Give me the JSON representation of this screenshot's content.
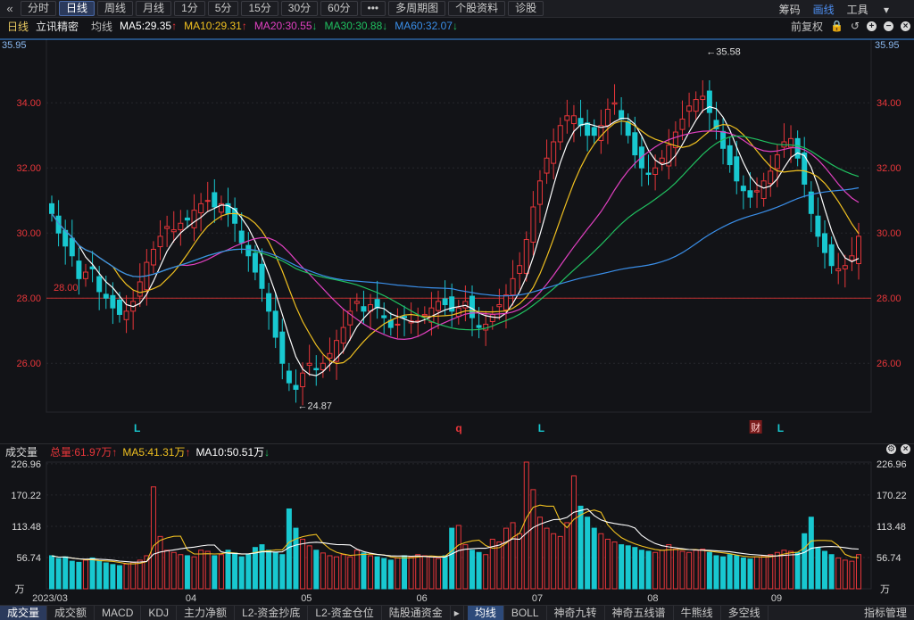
{
  "toolbar": {
    "back_icon": "double-chevron-left",
    "buttons": [
      "分时",
      "日线",
      "周线",
      "月线",
      "1分",
      "5分",
      "15分",
      "30分",
      "60分",
      "•••",
      "多周期图",
      "个股资料",
      "诊股"
    ],
    "active_button": "日线",
    "right": {
      "chips": "筹码",
      "ruler": "画线",
      "tools": "工具",
      "tools_arrow": "▾"
    }
  },
  "legend": {
    "period": "日线",
    "stock": "立讯精密",
    "ma_label": "均线",
    "ma5": "MA5:29.35",
    "ma10": "MA10:29.31",
    "ma20": "MA20:30.55",
    "ma30": "MA30:30.88",
    "ma60": "MA60:32.07",
    "adjust": "前复权"
  },
  "colors": {
    "up": "#e8363a",
    "down": "#18c8d0",
    "ma5": "#ffffff",
    "ma10": "#f0c020",
    "ma20": "#e040c0",
    "ma30": "#20c060",
    "ma60": "#3a8ee8",
    "grid": "#26272d",
    "axis_text": "#e8363a"
  },
  "markers": {
    "high_label": "35.58",
    "low_label": "24.87",
    "ref_line": "28.00",
    "top_right_price": "35.95",
    "top_left_price": "35.95",
    "signals": [
      "L",
      "q",
      "L",
      "财",
      "L"
    ]
  },
  "volume": {
    "title": "成交量",
    "total": "总量:61.97万",
    "ma5": "MA5:41.31万",
    "ma10": "MA10:50.51万",
    "unit": "万"
  },
  "x_labels": [
    "2023/03",
    "04",
    "05",
    "06",
    "07",
    "08",
    "09"
  ],
  "bottom_tabs": [
    "成交量",
    "成交额",
    "MACD",
    "KDJ",
    "主力净额",
    "L2-资金抄底",
    "L2-资金仓位",
    "陆股通资金",
    "均线",
    "BOLL",
    "神奇九转",
    "神奇五线谱",
    "牛熊线",
    "多空线",
    "指标管理"
  ],
  "chart_data": {
    "type": "candlestick",
    "title": "",
    "price_axis": {
      "ticks": [
        26.0,
        28.0,
        30.0,
        32.0,
        34.0
      ],
      "ylim": [
        24.5,
        35.95
      ]
    },
    "volume_axis": {
      "ticks": [
        56.74,
        113.48,
        170.22,
        226.96
      ],
      "unit": "万"
    },
    "months": [
      "2023/03",
      "04",
      "05",
      "06",
      "07",
      "08",
      "09"
    ],
    "close": [
      30.6,
      30.0,
      29.6,
      29.3,
      28.6,
      28.8,
      28.9,
      28.2,
      28.0,
      27.7,
      27.5,
      27.6,
      27.9,
      28.5,
      29.1,
      29.5,
      29.9,
      30.2,
      30.1,
      30.3,
      30.4,
      30.7,
      30.9,
      31.0,
      30.8,
      30.9,
      30.6,
      30.3,
      29.7,
      29.3,
      28.8,
      28.3,
      27.6,
      26.8,
      26.0,
      25.4,
      25.2,
      25.7,
      26.0,
      25.8,
      26.0,
      26.3,
      26.7,
      27.1,
      27.6,
      27.9,
      27.6,
      27.8,
      27.7,
      27.4,
      27.1,
      27.2,
      27.4,
      27.3,
      27.3,
      27.5,
      27.7,
      27.9,
      27.8,
      27.6,
      27.7,
      27.9,
      27.4,
      27.1,
      27.2,
      27.5,
      27.8,
      28.1,
      28.6,
      29.0,
      29.8,
      30.8,
      31.6,
      32.3,
      32.8,
      33.3,
      33.6,
      33.6,
      33.3,
      33.0,
      33.0,
      33.3,
      33.8,
      34.0,
      33.5,
      33.0,
      32.4,
      32.0,
      31.8,
      32.0,
      32.3,
      32.7,
      33.1,
      33.5,
      33.9,
      34.1,
      34.2,
      33.7,
      33.2,
      32.6,
      32.1,
      31.6,
      31.3,
      31.1,
      31.3,
      31.6,
      31.9,
      32.4,
      32.8,
      32.9,
      32.3,
      31.5,
      30.6,
      29.9,
      29.4,
      29.0,
      28.9,
      29.0,
      29.3,
      29.9
    ],
    "volume": [
      60,
      55,
      58,
      50,
      48,
      52,
      56,
      50,
      47,
      44,
      42,
      45,
      48,
      52,
      60,
      185,
      95,
      70,
      66,
      62,
      60,
      58,
      70,
      68,
      60,
      62,
      70,
      65,
      58,
      62,
      75,
      80,
      70,
      66,
      62,
      145,
      110,
      90,
      78,
      70,
      65,
      60,
      58,
      62,
      58,
      70,
      65,
      60,
      58,
      55,
      52,
      56,
      60,
      58,
      62,
      60,
      58,
      55,
      60,
      110,
      115,
      80,
      70,
      66,
      62,
      90,
      85,
      110,
      120,
      100,
      230,
      180,
      130,
      110,
      100,
      95,
      120,
      205,
      150,
      130,
      110,
      100,
      90,
      85,
      80,
      78,
      75,
      70,
      68,
      66,
      70,
      80,
      72,
      68,
      66,
      70,
      72,
      66,
      60,
      58,
      62,
      60,
      56,
      54,
      58,
      60,
      62,
      66,
      70,
      68,
      66,
      100,
      130,
      75,
      68,
      62,
      56,
      52,
      50,
      62
    ]
  }
}
